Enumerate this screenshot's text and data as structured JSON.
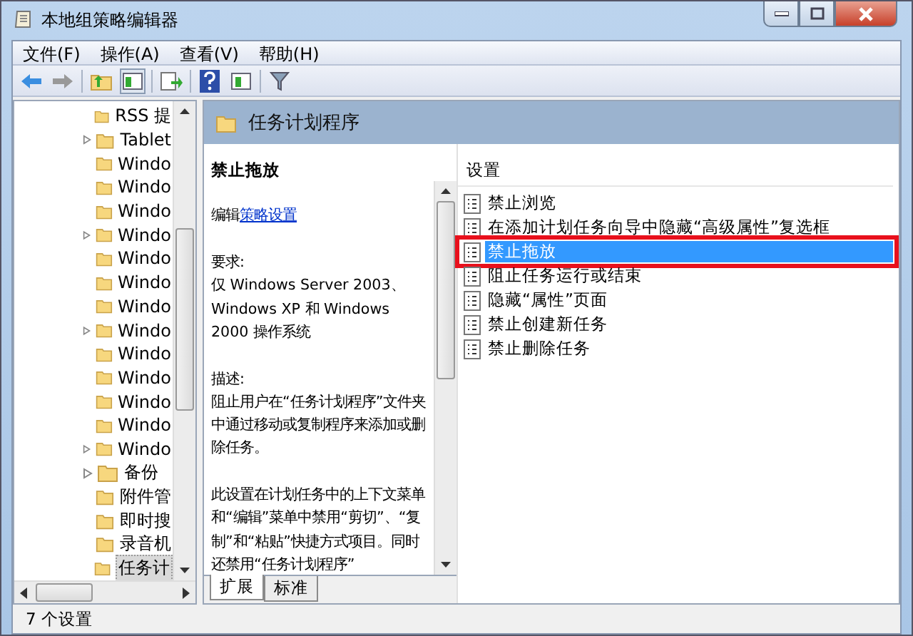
{
  "window": {
    "title": "本地组策略编辑器"
  },
  "menu": [
    "文件(F)",
    "操作(A)",
    "查看(V)",
    "帮助(H)"
  ],
  "tree": {
    "items": [
      {
        "label": "RSS 提",
        "expandable": false,
        "selected": false
      },
      {
        "label": "Tablet",
        "expandable": true,
        "selected": false
      },
      {
        "label": "Windo",
        "expandable": false,
        "selected": false
      },
      {
        "label": "Windo",
        "expandable": false,
        "selected": false
      },
      {
        "label": "Windo",
        "expandable": false,
        "selected": false
      },
      {
        "label": "Windo",
        "expandable": true,
        "selected": false
      },
      {
        "label": "Windo",
        "expandable": false,
        "selected": false
      },
      {
        "label": "Windo",
        "expandable": false,
        "selected": false
      },
      {
        "label": "Windo",
        "expandable": false,
        "selected": false
      },
      {
        "label": "Windo",
        "expandable": true,
        "selected": false
      },
      {
        "label": "Windo",
        "expandable": false,
        "selected": false
      },
      {
        "label": "Windo",
        "expandable": false,
        "selected": false
      },
      {
        "label": "Windo",
        "expandable": false,
        "selected": false
      },
      {
        "label": "Windo",
        "expandable": false,
        "selected": false
      },
      {
        "label": "Windo",
        "expandable": true,
        "selected": false
      },
      {
        "label": "备份",
        "expandable": true,
        "selected": false
      },
      {
        "label": "附件管",
        "expandable": false,
        "selected": false
      },
      {
        "label": "即时搜",
        "expandable": false,
        "selected": false
      },
      {
        "label": "录音机",
        "expandable": false,
        "selected": false
      },
      {
        "label": "任务计",
        "expandable": false,
        "selected": true
      }
    ]
  },
  "content": {
    "title": "任务计划程序",
    "description": {
      "heading": "禁止拖放",
      "edit_prefix": "编辑",
      "edit_link": "策略设置",
      "paragraphs": [
        "要求:",
        "仅 Windows Server 2003、Windows XP 和 Windows 2000 操作系统",
        "描述:",
        "阻止用户在“任务计划程序”文件夹中通过移动或复制程序来添加或删除任务。",
        "此设置在计划任务中的上下文菜单和“编辑”菜单中禁用“剪切”、“复制”和“粘贴”快捷方式项目。同时还禁用“任务计划程序”"
      ]
    },
    "list": {
      "column": "设置",
      "items": [
        {
          "label": "禁止浏览",
          "selected": false
        },
        {
          "label": "在添加计划任务向导中隐藏“高级属性”复选框",
          "selected": false
        },
        {
          "label": "禁止拖放",
          "selected": true
        },
        {
          "label": "阻止任务运行或结束",
          "selected": false
        },
        {
          "label": "隐藏“属性”页面",
          "selected": false
        },
        {
          "label": "禁止创建新任务",
          "selected": false
        },
        {
          "label": "禁止删除任务",
          "selected": false
        }
      ]
    },
    "tabs": [
      {
        "label": "扩展",
        "selected": true
      },
      {
        "label": "标准",
        "selected": false
      }
    ]
  },
  "status_bar": "7 个设置"
}
